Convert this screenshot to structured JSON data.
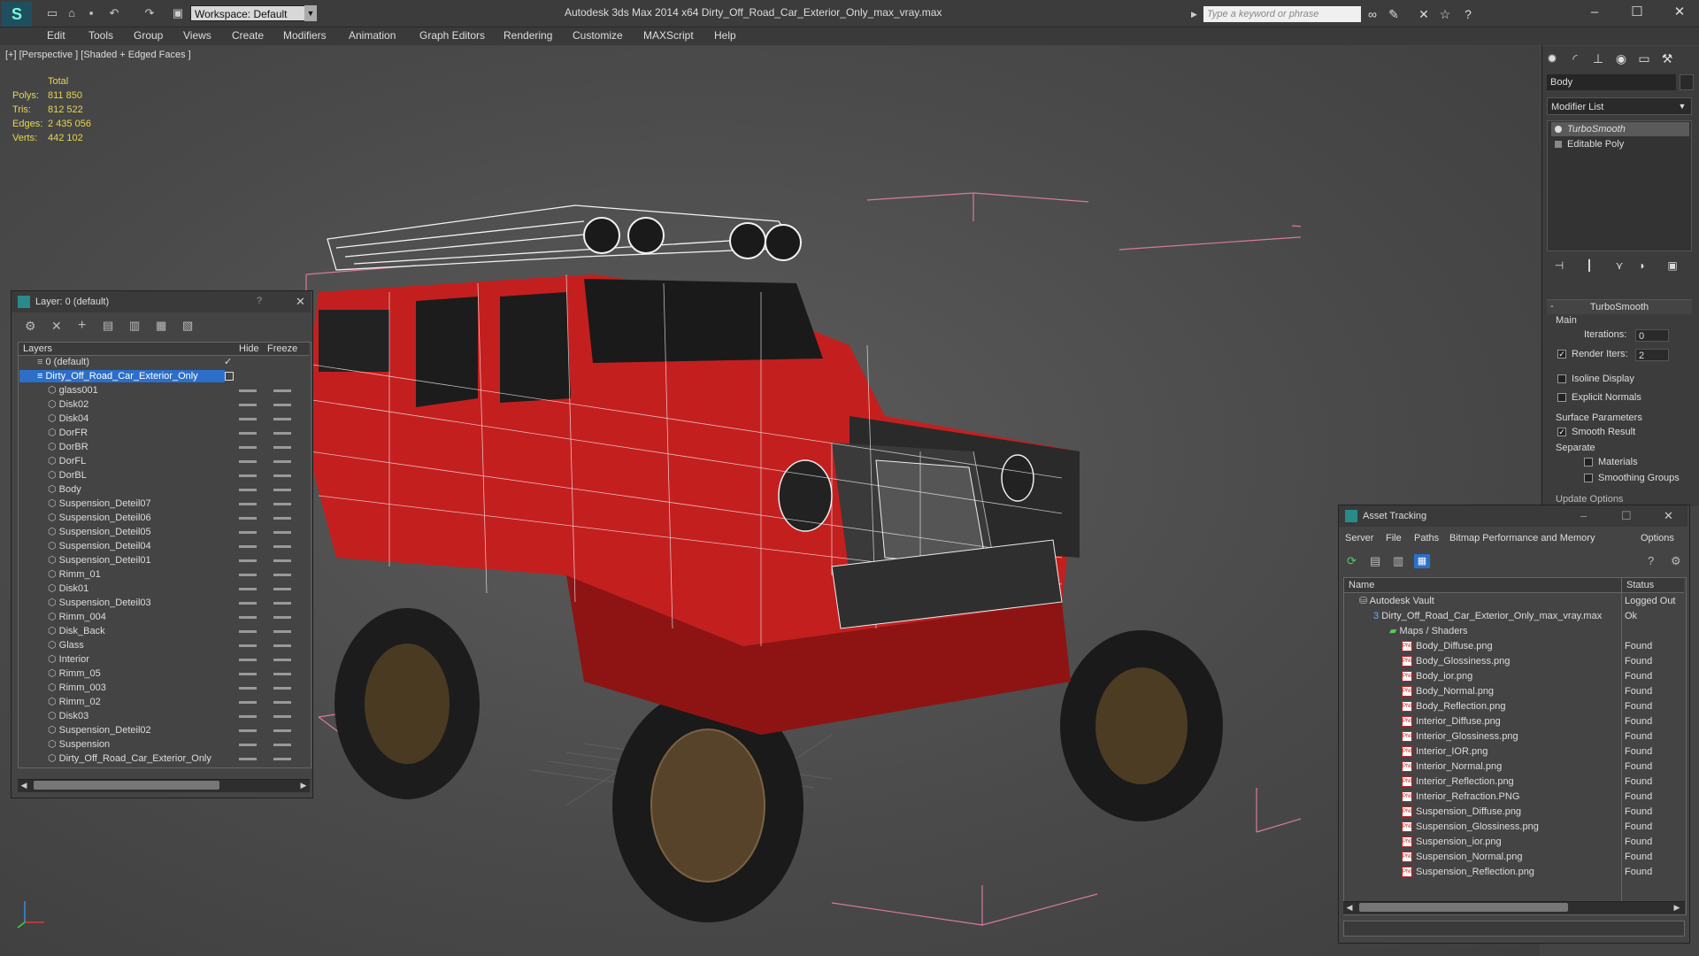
{
  "app": {
    "title": "Autodesk 3ds Max 2014 x64      Dirty_Off_Road_Car_Exterior_Only_max_vray.max",
    "workspace": "Workspace: Default",
    "search_placeholder": "Type a keyword or phrase"
  },
  "menu": [
    "Edit",
    "Tools",
    "Group",
    "Views",
    "Create",
    "Modifiers",
    "Animation",
    "Graph Editors",
    "Rendering",
    "Customize",
    "MAXScript",
    "Help"
  ],
  "viewport": {
    "label": "[+] [Perspective ] [Shaded + Edged Faces ]",
    "stats_header": "Total",
    "stats": [
      {
        "label": "Polys:",
        "value": "811 850"
      },
      {
        "label": "Tris:",
        "value": "812 522"
      },
      {
        "label": "Edges:",
        "value": "2 435 056"
      },
      {
        "label": "Verts:",
        "value": "442 102"
      }
    ]
  },
  "command_panel": {
    "object_name": "Body",
    "modifier_list": "Modifier List",
    "stack": [
      "TurboSmooth",
      "Editable Poly"
    ],
    "rollout_title": "TurboSmooth",
    "main_label": "Main",
    "iterations_label": "Iterations:",
    "iterations_value": "0",
    "render_iters_label": "Render Iters:",
    "render_iters_value": "2",
    "isoline": "Isoline Display",
    "explicit_normals": "Explicit Normals",
    "surface_params": "Surface Parameters",
    "smooth_result": "Smooth Result",
    "separate": "Separate",
    "materials": "Materials",
    "smoothing_groups": "Smoothing Groups",
    "update_options": "Update Options"
  },
  "layer_panel": {
    "title": "Layer: 0 (default)",
    "question": "?",
    "columns": {
      "layers": "Layers",
      "hide": "Hide",
      "freeze": "Freeze"
    },
    "layers": [
      {
        "name": "0 (default)",
        "level": 0
      },
      {
        "name": "Dirty_Off_Road_Car_Exterior_Only",
        "level": 0,
        "selected": true
      }
    ],
    "objects": [
      "glass001",
      "Disk02",
      "Disk04",
      "DorFR",
      "DorBR",
      "DorFL",
      "DorBL",
      "Body",
      "Suspension_Deteil07",
      "Suspension_Deteil06",
      "Suspension_Deteil05",
      "Suspension_Deteil04",
      "Suspension_Deteil01",
      "Rimm_01",
      "Disk01",
      "Suspension_Deteil03",
      "Rimm_004",
      "Disk_Back",
      "Glass",
      "Interior",
      "Rimm_05",
      "Rimm_003",
      "Rimm_02",
      "Disk03",
      "Suspension_Deteil02",
      "Suspension",
      "Dirty_Off_Road_Car_Exterior_Only"
    ]
  },
  "asset_panel": {
    "title": "Asset Tracking",
    "menu": [
      "Server",
      "File",
      "Paths",
      "Bitmap Performance and Memory",
      "Options"
    ],
    "columns": {
      "name": "Name",
      "status": "Status"
    },
    "vault": {
      "name": "Autodesk Vault",
      "status": "Logged Out"
    },
    "scene": {
      "name": "Dirty_Off_Road_Car_Exterior_Only_max_vray.max",
      "status": "Ok"
    },
    "maps_folder": "Maps / Shaders",
    "files": [
      {
        "name": "Body_Diffuse.png",
        "status": "Found"
      },
      {
        "name": "Body_Glossiness.png",
        "status": "Found"
      },
      {
        "name": "Body_ior.png",
        "status": "Found"
      },
      {
        "name": "Body_Normal.png",
        "status": "Found"
      },
      {
        "name": "Body_Reflection.png",
        "status": "Found"
      },
      {
        "name": "Interior_Diffuse.png",
        "status": "Found"
      },
      {
        "name": "Interior_Glossiness.png",
        "status": "Found"
      },
      {
        "name": "Interior_IOR.png",
        "status": "Found"
      },
      {
        "name": "Interior_Normal.png",
        "status": "Found"
      },
      {
        "name": "Interior_Reflection.png",
        "status": "Found"
      },
      {
        "name": "Interior_Refraction.PNG",
        "status": "Found"
      },
      {
        "name": "Suspension_Diffuse.png",
        "status": "Found"
      },
      {
        "name": "Suspension_Glossiness.png",
        "status": "Found"
      },
      {
        "name": "Suspension_ior.png",
        "status": "Found"
      },
      {
        "name": "Suspension_Normal.png",
        "status": "Found"
      },
      {
        "name": "Suspension_Reflection.png",
        "status": "Found"
      }
    ]
  },
  "colors": {
    "car_red": "#c41f1f",
    "wire_white": "#f2f2f2",
    "bbox_pink": "#d77aa0",
    "stats_yellow": "#e8d650",
    "selection_blue": "#2b6fc9"
  }
}
